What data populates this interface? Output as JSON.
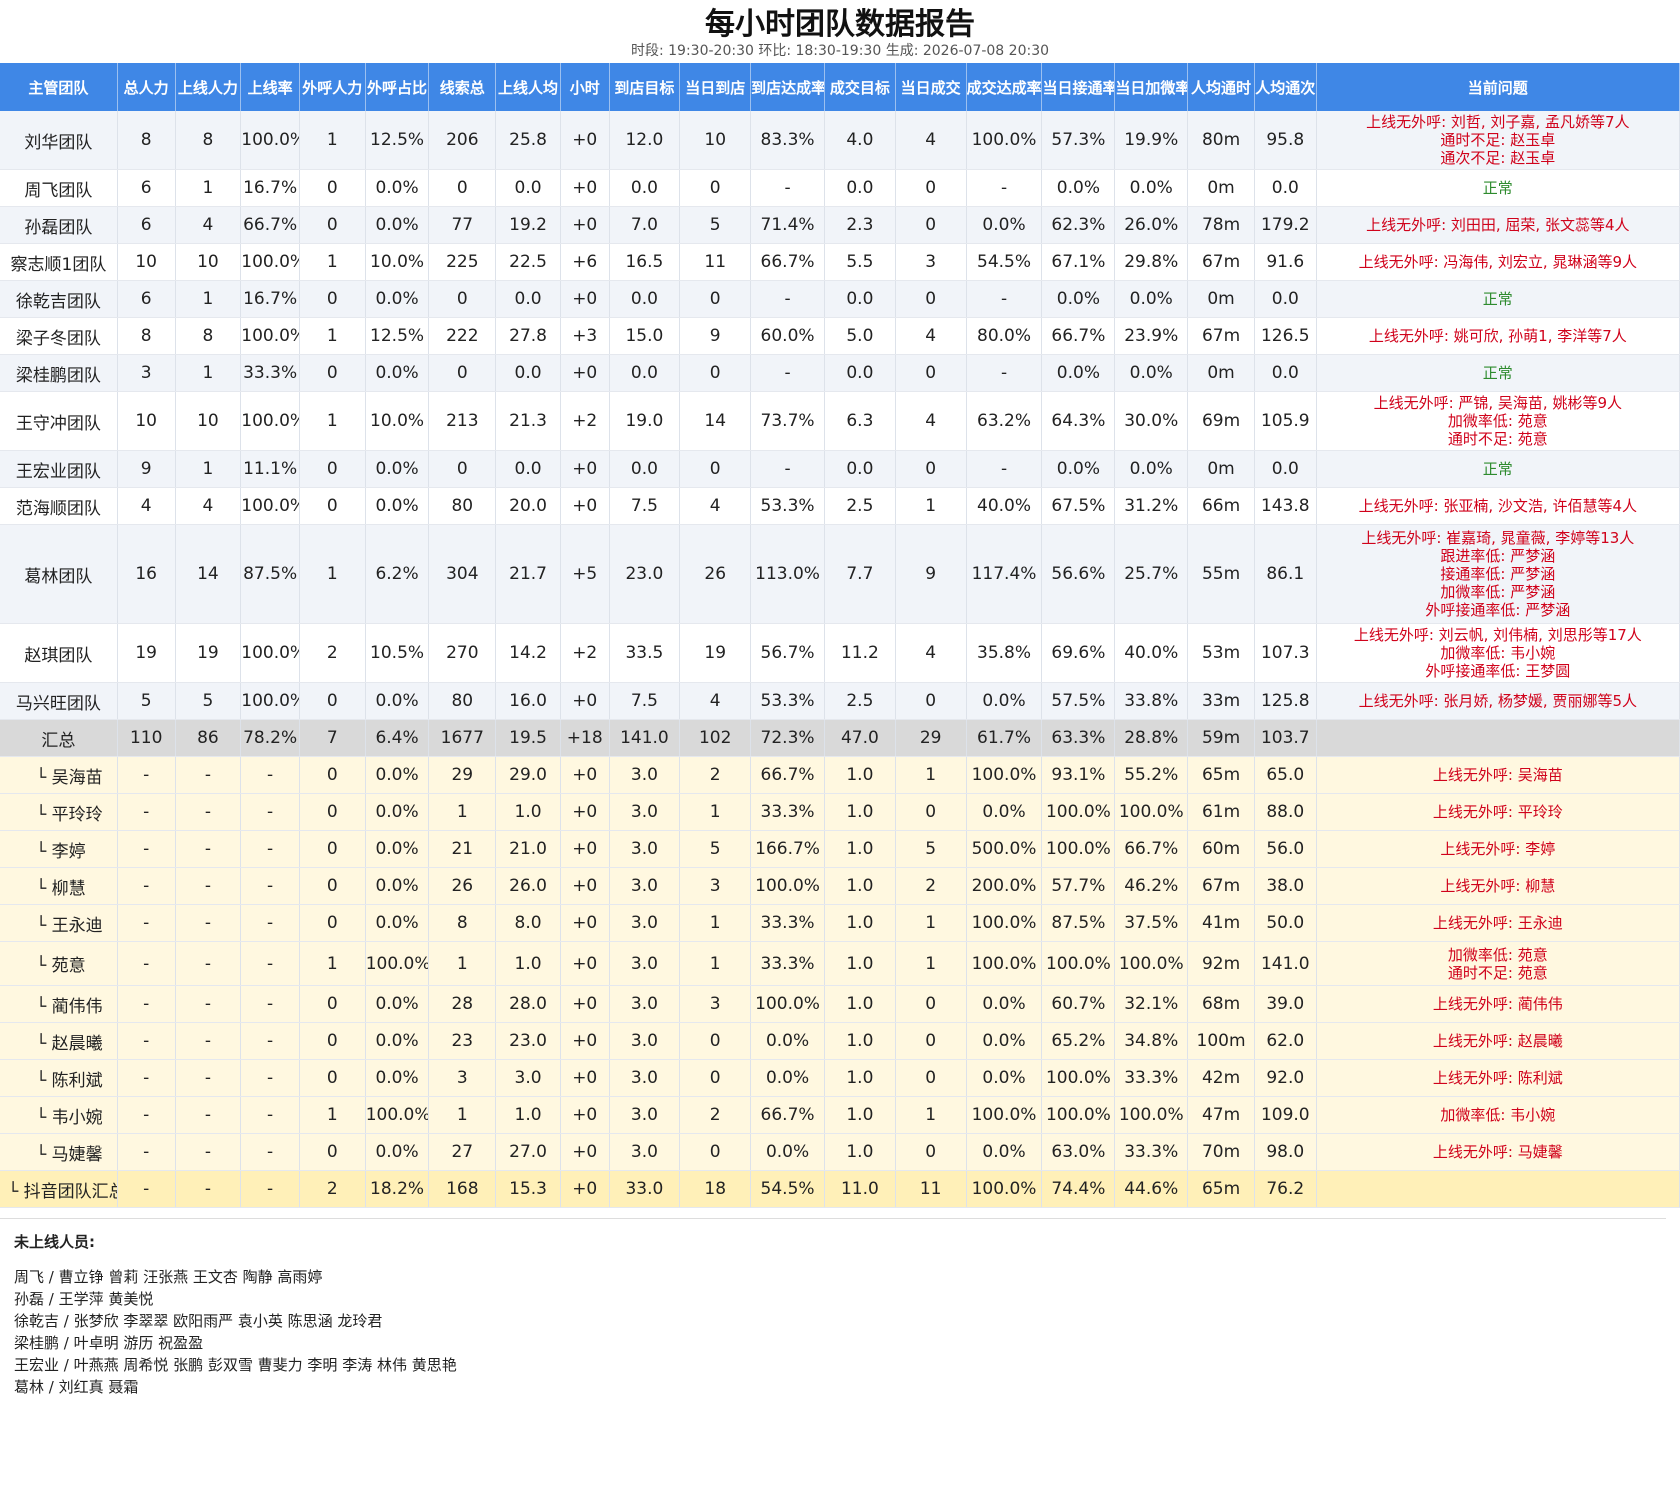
{
  "title": "每小时团队数据报告",
  "subtitle": "时段: 19:30-20:30   环比: 18:30-19:30   生成: 2026-07-08 20:30",
  "columns": [
    "主管团队",
    "总人力",
    "上线人力",
    "上线率",
    "外呼人力",
    "外呼占比",
    "线索总",
    "上线人均",
    "小时",
    "到店目标",
    "当日到店",
    "到店达成率",
    "成交目标",
    "当日成交",
    "成交达成率",
    "当日接通率",
    "当日加微率",
    "人均通时",
    "人均通次",
    "当前问题"
  ],
  "teams": [
    {
      "c": [
        "刘华团队",
        "8",
        "8",
        "100.0%",
        "1",
        "12.5%",
        "206",
        "25.8",
        "+0",
        "12.0",
        "10",
        "83.3%",
        "4.0",
        "4",
        "100.0%",
        "57.3%",
        "19.9%",
        "80m",
        "95.8"
      ],
      "issues": [
        "上线无外呼: 刘哲, 刘子嘉, 孟凡娇等7人",
        "通时不足: 赵玉卓",
        "通次不足: 赵玉卓"
      ],
      "ok": false
    },
    {
      "c": [
        "周飞团队",
        "6",
        "1",
        "16.7%",
        "0",
        "0.0%",
        "0",
        "0.0",
        "+0",
        "0.0",
        "0",
        "-",
        "0.0",
        "0",
        "-",
        "0.0%",
        "0.0%",
        "0m",
        "0.0"
      ],
      "issues": [
        "正常"
      ],
      "ok": true
    },
    {
      "c": [
        "孙磊团队",
        "6",
        "4",
        "66.7%",
        "0",
        "0.0%",
        "77",
        "19.2",
        "+0",
        "7.0",
        "5",
        "71.4%",
        "2.3",
        "0",
        "0.0%",
        "62.3%",
        "26.0%",
        "78m",
        "179.2"
      ],
      "issues": [
        "上线无外呼: 刘田田, 屈荣, 张文蕊等4人"
      ],
      "ok": false
    },
    {
      "c": [
        "察志顺1团队",
        "10",
        "10",
        "100.0%",
        "1",
        "10.0%",
        "225",
        "22.5",
        "+6",
        "16.5",
        "11",
        "66.7%",
        "5.5",
        "3",
        "54.5%",
        "67.1%",
        "29.8%",
        "67m",
        "91.6"
      ],
      "issues": [
        "上线无外呼: 冯海伟, 刘宏立, 晁琳涵等9人"
      ],
      "ok": false
    },
    {
      "c": [
        "徐乾吉团队",
        "6",
        "1",
        "16.7%",
        "0",
        "0.0%",
        "0",
        "0.0",
        "+0",
        "0.0",
        "0",
        "-",
        "0.0",
        "0",
        "-",
        "0.0%",
        "0.0%",
        "0m",
        "0.0"
      ],
      "issues": [
        "正常"
      ],
      "ok": true
    },
    {
      "c": [
        "梁子冬团队",
        "8",
        "8",
        "100.0%",
        "1",
        "12.5%",
        "222",
        "27.8",
        "+3",
        "15.0",
        "9",
        "60.0%",
        "5.0",
        "4",
        "80.0%",
        "66.7%",
        "23.9%",
        "67m",
        "126.5"
      ],
      "issues": [
        "上线无外呼: 姚可欣, 孙萌1, 李洋等7人"
      ],
      "ok": false
    },
    {
      "c": [
        "梁桂鹏团队",
        "3",
        "1",
        "33.3%",
        "0",
        "0.0%",
        "0",
        "0.0",
        "+0",
        "0.0",
        "0",
        "-",
        "0.0",
        "0",
        "-",
        "0.0%",
        "0.0%",
        "0m",
        "0.0"
      ],
      "issues": [
        "正常"
      ],
      "ok": true
    },
    {
      "c": [
        "王守冲团队",
        "10",
        "10",
        "100.0%",
        "1",
        "10.0%",
        "213",
        "21.3",
        "+2",
        "19.0",
        "14",
        "73.7%",
        "6.3",
        "4",
        "63.2%",
        "64.3%",
        "30.0%",
        "69m",
        "105.9"
      ],
      "issues": [
        "上线无外呼: 严锦, 吴海苗, 姚彬等9人",
        "加微率低: 苑意",
        "通时不足: 苑意"
      ],
      "ok": false
    },
    {
      "c": [
        "王宏业团队",
        "9",
        "1",
        "11.1%",
        "0",
        "0.0%",
        "0",
        "0.0",
        "+0",
        "0.0",
        "0",
        "-",
        "0.0",
        "0",
        "-",
        "0.0%",
        "0.0%",
        "0m",
        "0.0"
      ],
      "issues": [
        "正常"
      ],
      "ok": true
    },
    {
      "c": [
        "范海顺团队",
        "4",
        "4",
        "100.0%",
        "0",
        "0.0%",
        "80",
        "20.0",
        "+0",
        "7.5",
        "4",
        "53.3%",
        "2.5",
        "1",
        "40.0%",
        "67.5%",
        "31.2%",
        "66m",
        "143.8"
      ],
      "issues": [
        "上线无外呼: 张亚楠, 沙文浩, 许佰慧等4人"
      ],
      "ok": false
    },
    {
      "c": [
        "葛林团队",
        "16",
        "14",
        "87.5%",
        "1",
        "6.2%",
        "304",
        "21.7",
        "+5",
        "23.0",
        "26",
        "113.0%",
        "7.7",
        "9",
        "117.4%",
        "56.6%",
        "25.7%",
        "55m",
        "86.1"
      ],
      "issues": [
        "上线无外呼: 崔嘉琦, 晁童薇, 李婷等13人",
        "跟进率低: 严梦涵",
        "接通率低: 严梦涵",
        "加微率低: 严梦涵",
        "外呼接通率低: 严梦涵"
      ],
      "ok": false
    },
    {
      "c": [
        "赵琪团队",
        "19",
        "19",
        "100.0%",
        "2",
        "10.5%",
        "270",
        "14.2",
        "+2",
        "33.5",
        "19",
        "56.7%",
        "11.2",
        "4",
        "35.8%",
        "69.6%",
        "40.0%",
        "53m",
        "107.3"
      ],
      "issues": [
        "上线无外呼: 刘云帆, 刘伟楠, 刘思彤等17人",
        "加微率低: 韦小婉",
        "外呼接通率低: 王梦圆"
      ],
      "ok": false
    },
    {
      "c": [
        "马兴旺团队",
        "5",
        "5",
        "100.0%",
        "0",
        "0.0%",
        "80",
        "16.0",
        "+0",
        "7.5",
        "4",
        "53.3%",
        "2.5",
        "0",
        "0.0%",
        "57.5%",
        "33.8%",
        "33m",
        "125.8"
      ],
      "issues": [
        "上线无外呼: 张月娇, 杨梦媛, 贾丽娜等5人"
      ],
      "ok": false
    }
  ],
  "total": {
    "c": [
      "汇总",
      "110",
      "86",
      "78.2%",
      "7",
      "6.4%",
      "1677",
      "19.5",
      "+18",
      "141.0",
      "102",
      "72.3%",
      "47.0",
      "29",
      "61.7%",
      "63.3%",
      "28.8%",
      "59m",
      "103.7"
    ],
    "issues": []
  },
  "members": [
    {
      "c": [
        "└ 吴海苗",
        "-",
        "-",
        "-",
        "0",
        "0.0%",
        "29",
        "29.0",
        "+0",
        "3.0",
        "2",
        "66.7%",
        "1.0",
        "1",
        "100.0%",
        "93.1%",
        "55.2%",
        "65m",
        "65.0"
      ],
      "issues": [
        "上线无外呼: 吴海苗"
      ]
    },
    {
      "c": [
        "└ 平玲玲",
        "-",
        "-",
        "-",
        "0",
        "0.0%",
        "1",
        "1.0",
        "+0",
        "3.0",
        "1",
        "33.3%",
        "1.0",
        "0",
        "0.0%",
        "100.0%",
        "100.0%",
        "61m",
        "88.0"
      ],
      "issues": [
        "上线无外呼: 平玲玲"
      ]
    },
    {
      "c": [
        "└ 李婷",
        "-",
        "-",
        "-",
        "0",
        "0.0%",
        "21",
        "21.0",
        "+0",
        "3.0",
        "5",
        "166.7%",
        "1.0",
        "5",
        "500.0%",
        "100.0%",
        "66.7%",
        "60m",
        "56.0"
      ],
      "issues": [
        "上线无外呼: 李婷"
      ]
    },
    {
      "c": [
        "└ 柳慧",
        "-",
        "-",
        "-",
        "0",
        "0.0%",
        "26",
        "26.0",
        "+0",
        "3.0",
        "3",
        "100.0%",
        "1.0",
        "2",
        "200.0%",
        "57.7%",
        "46.2%",
        "67m",
        "38.0"
      ],
      "issues": [
        "上线无外呼: 柳慧"
      ]
    },
    {
      "c": [
        "└ 王永迪",
        "-",
        "-",
        "-",
        "0",
        "0.0%",
        "8",
        "8.0",
        "+0",
        "3.0",
        "1",
        "33.3%",
        "1.0",
        "1",
        "100.0%",
        "87.5%",
        "37.5%",
        "41m",
        "50.0"
      ],
      "issues": [
        "上线无外呼: 王永迪"
      ]
    },
    {
      "c": [
        "└ 苑意",
        "-",
        "-",
        "-",
        "1",
        "100.0%",
        "1",
        "1.0",
        "+0",
        "3.0",
        "1",
        "33.3%",
        "1.0",
        "1",
        "100.0%",
        "100.0%",
        "100.0%",
        "92m",
        "141.0"
      ],
      "issues": [
        "加微率低: 苑意",
        "通时不足: 苑意"
      ]
    },
    {
      "c": [
        "└ 蔺伟伟",
        "-",
        "-",
        "-",
        "0",
        "0.0%",
        "28",
        "28.0",
        "+0",
        "3.0",
        "3",
        "100.0%",
        "1.0",
        "0",
        "0.0%",
        "60.7%",
        "32.1%",
        "68m",
        "39.0"
      ],
      "issues": [
        "上线无外呼: 蔺伟伟"
      ]
    },
    {
      "c": [
        "└ 赵晨曦",
        "-",
        "-",
        "-",
        "0",
        "0.0%",
        "23",
        "23.0",
        "+0",
        "3.0",
        "0",
        "0.0%",
        "1.0",
        "0",
        "0.0%",
        "65.2%",
        "34.8%",
        "100m",
        "62.0"
      ],
      "issues": [
        "上线无外呼: 赵晨曦"
      ]
    },
    {
      "c": [
        "└ 陈利斌",
        "-",
        "-",
        "-",
        "0",
        "0.0%",
        "3",
        "3.0",
        "+0",
        "3.0",
        "0",
        "0.0%",
        "1.0",
        "0",
        "0.0%",
        "100.0%",
        "33.3%",
        "42m",
        "92.0"
      ],
      "issues": [
        "上线无外呼: 陈利斌"
      ]
    },
    {
      "c": [
        "└ 韦小婉",
        "-",
        "-",
        "-",
        "1",
        "100.0%",
        "1",
        "1.0",
        "+0",
        "3.0",
        "2",
        "66.7%",
        "1.0",
        "1",
        "100.0%",
        "100.0%",
        "100.0%",
        "47m",
        "109.0"
      ],
      "issues": [
        "加微率低: 韦小婉"
      ]
    },
    {
      "c": [
        "└ 马婕馨",
        "-",
        "-",
        "-",
        "0",
        "0.0%",
        "27",
        "27.0",
        "+0",
        "3.0",
        "0",
        "0.0%",
        "1.0",
        "0",
        "0.0%",
        "63.0%",
        "33.3%",
        "70m",
        "98.0"
      ],
      "issues": [
        "上线无外呼: 马婕馨"
      ]
    }
  ],
  "subtotal": {
    "c": [
      "└ 抖音团队汇总",
      "-",
      "-",
      "-",
      "2",
      "18.2%",
      "168",
      "15.3",
      "+0",
      "33.0",
      "18",
      "54.5%",
      "11.0",
      "11",
      "100.0%",
      "74.4%",
      "44.6%",
      "65m",
      "76.2"
    ],
    "issues": []
  },
  "offline": {
    "title": "未上线人员:",
    "lines": [
      "周飞 / 曹立铮 曾莉 汪张燕 王文杏 陶静 高雨婷",
      "孙磊 / 王学萍 黄美悦",
      "徐乾吉 / 张梦欣 李翠翠 欧阳雨严 袁小英 陈思涵 龙玲君",
      "梁桂鹏 / 叶卓明 游历 祝盈盈",
      "王宏业 / 叶燕燕 周希悦 张鹏 彭双雪 曹斐力 李明 李涛 林伟 黄思艳",
      "葛林 / 刘红真 聂霜"
    ]
  },
  "colors": {
    "header_bg": "#3f87e6",
    "issue_red": "#d0021b",
    "ok_green": "#2e8b2e",
    "total_bg": "#d9d9d9",
    "member_bg": "#fff8e0",
    "subtotal_bg": "#fff0b8"
  }
}
